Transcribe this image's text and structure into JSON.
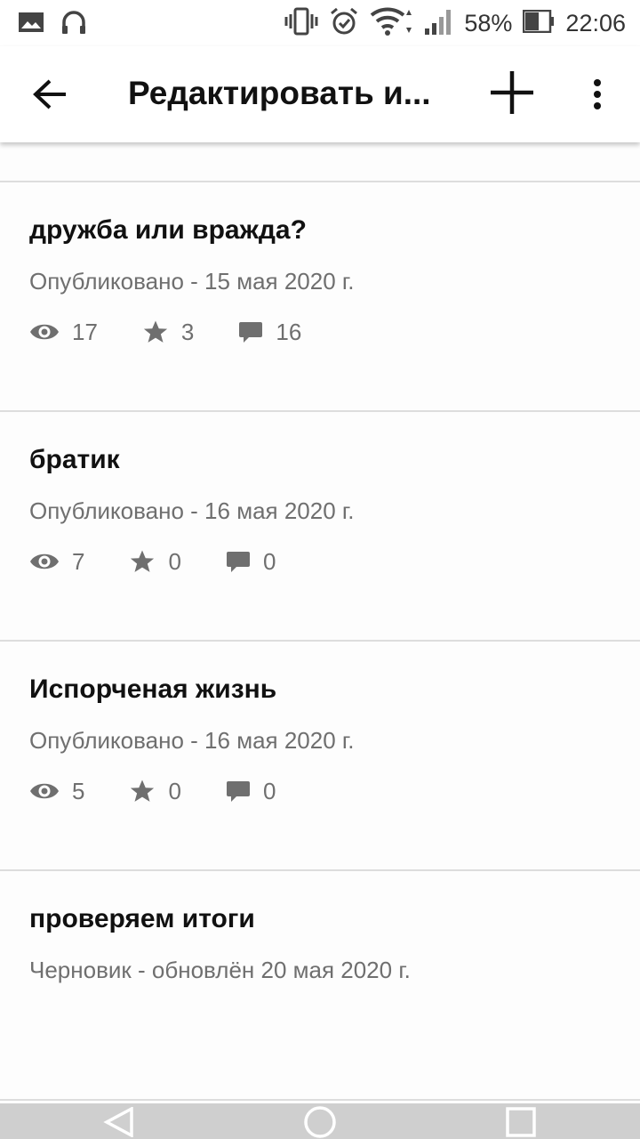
{
  "status_bar": {
    "battery_percent": "58%",
    "time": "22:06",
    "icons": [
      "image-icon",
      "headset-icon",
      "vibrate-icon",
      "alarm-icon",
      "wifi-icon",
      "signal-icon",
      "battery-icon"
    ]
  },
  "app_bar": {
    "title": "Редактировать и...",
    "actions": [
      "back-arrow-icon",
      "add-icon",
      "more-vertical-icon"
    ]
  },
  "posts": [
    {
      "title": "дружба или вражда?",
      "meta": "Опубликовано - 15 мая 2020 г.",
      "views": "17",
      "stars": "3",
      "comments": "16"
    },
    {
      "title": "братик",
      "meta": "Опубликовано - 16 мая 2020 г.",
      "views": "7",
      "stars": "0",
      "comments": "0"
    },
    {
      "title": "Испорченая жизнь",
      "meta": "Опубликовано - 16 мая 2020 г.",
      "views": "5",
      "stars": "0",
      "comments": "0"
    },
    {
      "title": "проверяем итоги",
      "meta": "Черновик - обновлён 20 мая 2020 г."
    }
  ],
  "colors": {
    "text_primary": "#111111",
    "text_secondary": "#6f6f6f",
    "divider": "#dddddd",
    "nav_bar": "#cfcfcf"
  }
}
